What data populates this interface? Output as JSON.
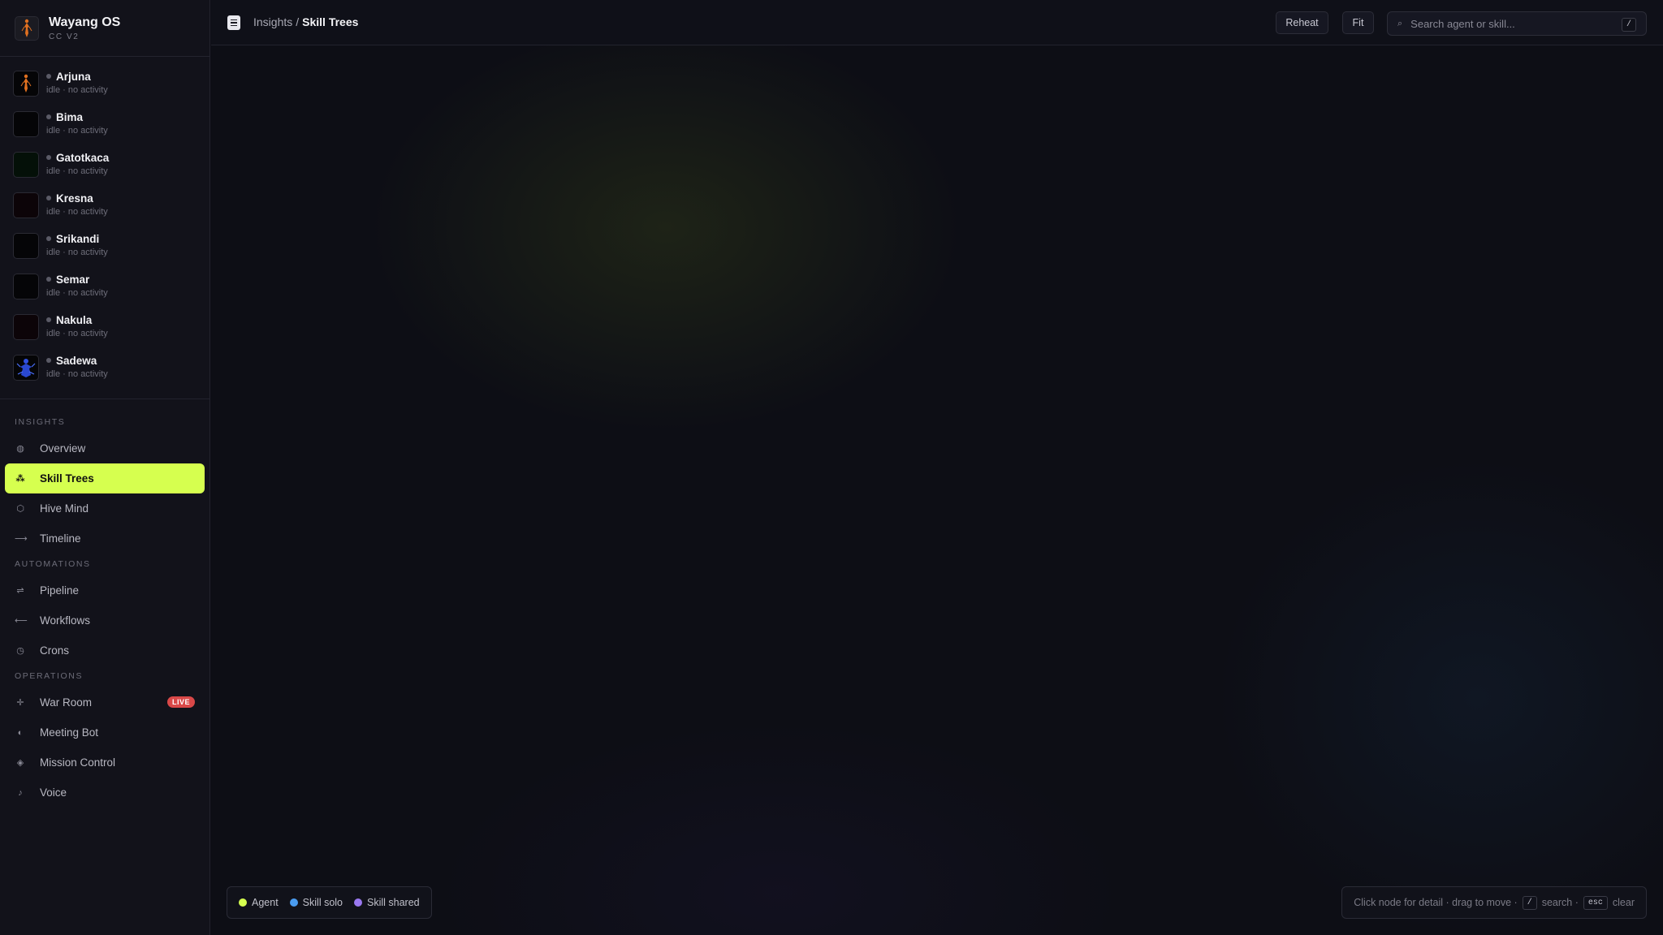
{
  "brand": {
    "name": "Wayang OS",
    "subtitle": "CC V2",
    "logo_icon": "wayang-puppet-icon"
  },
  "agents": [
    {
      "name": "Arjuna",
      "status": "idle · no activity",
      "avatar_icon": "wayang-puppet-icon",
      "avatar_color": "#e07020"
    },
    {
      "name": "Bima",
      "status": "idle · no activity",
      "avatar_icon": "dark-avatar-icon",
      "avatar_color": "#050507"
    },
    {
      "name": "Gatotkaca",
      "status": "idle · no activity",
      "avatar_icon": "dark-avatar-icon",
      "avatar_color": "#041008"
    },
    {
      "name": "Kresna",
      "status": "idle · no activity",
      "avatar_icon": "dark-avatar-icon",
      "avatar_color": "#0c0408"
    },
    {
      "name": "Srikandi",
      "status": "idle · no activity",
      "avatar_icon": "dark-avatar-icon",
      "avatar_color": "#050507"
    },
    {
      "name": "Semar",
      "status": "idle · no activity",
      "avatar_icon": "dark-avatar-icon",
      "avatar_color": "#050507"
    },
    {
      "name": "Nakula",
      "status": "idle · no activity",
      "avatar_icon": "dark-avatar-icon",
      "avatar_color": "#0c0408"
    },
    {
      "name": "Sadewa",
      "status": "idle · no activity",
      "avatar_icon": "blue-puppet-icon",
      "avatar_color": "#3050e0"
    }
  ],
  "nav": {
    "insights_label": "INSIGHTS",
    "automations_label": "AUTOMATIONS",
    "operations_label": "OPERATIONS",
    "insights": [
      {
        "label": "Overview",
        "icon": "overview-icon",
        "active": false
      },
      {
        "label": "Skill Trees",
        "icon": "skill-tree-icon",
        "active": true
      },
      {
        "label": "Hive Mind",
        "icon": "hive-icon",
        "active": false
      },
      {
        "label": "Timeline",
        "icon": "timeline-icon",
        "active": false
      }
    ],
    "automations": [
      {
        "label": "Pipeline",
        "icon": "pipeline-icon"
      },
      {
        "label": "Workflows",
        "icon": "workflow-icon"
      },
      {
        "label": "Crons",
        "icon": "clock-icon"
      }
    ],
    "operations": [
      {
        "label": "War Room",
        "icon": "crosshair-icon",
        "badge": "LIVE"
      },
      {
        "label": "Meeting Bot",
        "icon": "half-circle-icon"
      },
      {
        "label": "Mission Control",
        "icon": "diamond-icon"
      },
      {
        "label": "Voice",
        "icon": "music-note-icon"
      }
    ]
  },
  "topbar": {
    "breadcrumb_root": "Insights",
    "breadcrumb_separator": "/",
    "breadcrumb_current": "Skill Trees",
    "reheat_label": "Reheat",
    "fit_label": "Fit",
    "search_placeholder": "Search agent or skill...",
    "search_value": "",
    "search_shortcut": "/"
  },
  "legend": [
    {
      "label": "Agent",
      "color": "#d6ff4f"
    },
    {
      "label": "Skill solo",
      "color": "#4a9cf0"
    },
    {
      "label": "Skill shared",
      "color": "#9a78f0"
    }
  ],
  "hint": {
    "text_before": "Click node for detail · drag to move ·",
    "search_key": "/",
    "search_text": "search ·",
    "clear_key": "esc",
    "clear_text": "clear"
  },
  "colors": {
    "accent": "#d6ff4f",
    "live_badge": "#d94848",
    "background": "#0d0e15"
  }
}
